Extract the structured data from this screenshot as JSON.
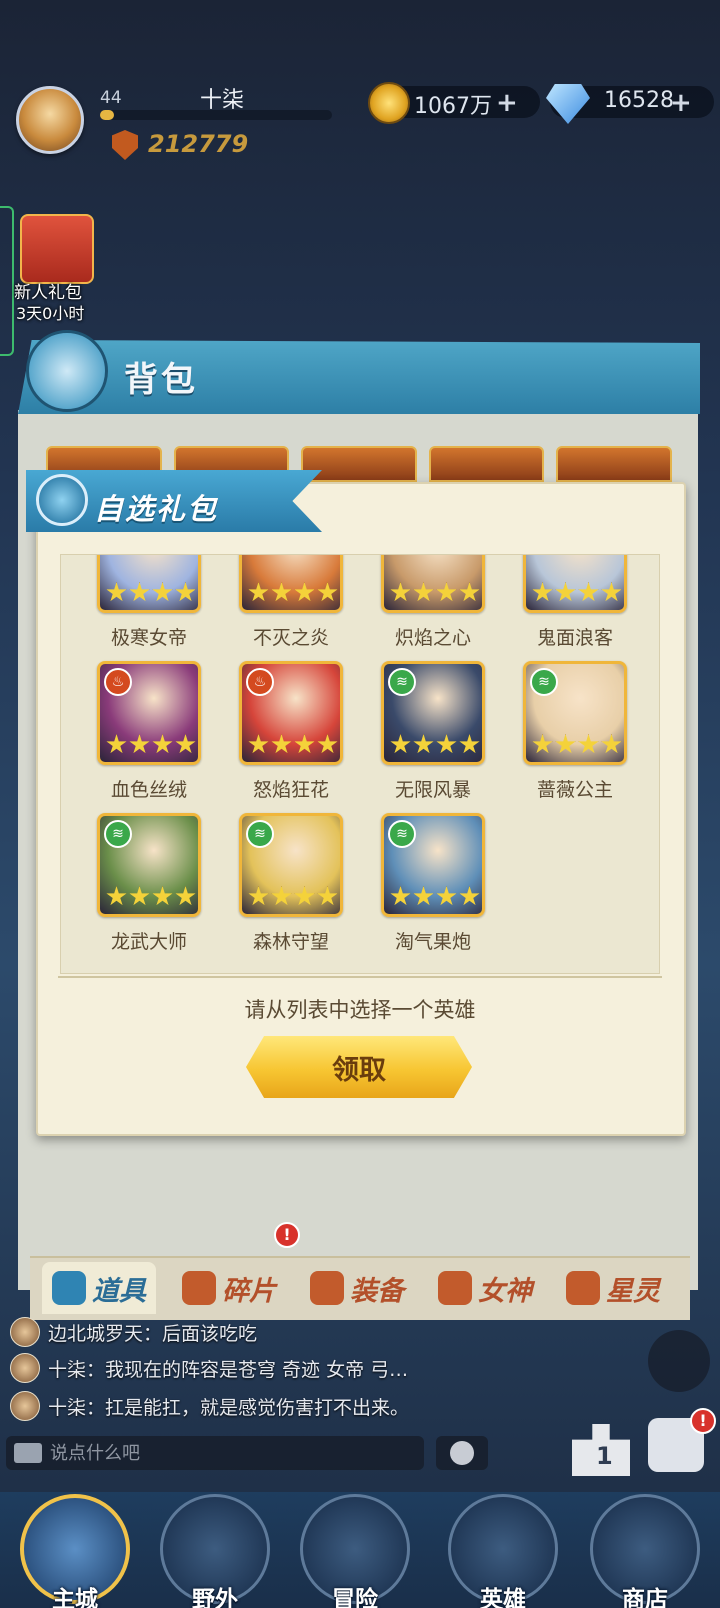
{
  "player": {
    "level": "44",
    "name": "十柒",
    "exp_fraction": 0.06,
    "power": "212779"
  },
  "resources": {
    "gold": "1067万",
    "gems": "16528",
    "plus_label": "+"
  },
  "side_event": {
    "label": "新人礼包",
    "timer": "3天0小时"
  },
  "backpack": {
    "title": "背包"
  },
  "popup": {
    "title": "自选礼包",
    "prompt": "请从列表中选择一个英雄",
    "claim_label": "领取",
    "heroes": [
      {
        "name": "极寒女帝",
        "element": "none",
        "stars": 4,
        "color": "#9fb4e0"
      },
      {
        "name": "不灭之炎",
        "element": "none",
        "stars": 4,
        "color": "#d87a3a"
      },
      {
        "name": "炽焰之心",
        "element": "none",
        "stars": 4,
        "color": "#c89a6a"
      },
      {
        "name": "鬼面浪客",
        "element": "none",
        "stars": 4,
        "color": "#b8c6d8"
      },
      {
        "name": "血色丝绒",
        "element": "fire",
        "stars": 4,
        "color": "#8a3b7a"
      },
      {
        "name": "怒焰狂花",
        "element": "fire",
        "stars": 4,
        "color": "#d6453a"
      },
      {
        "name": "无限风暴",
        "element": "wind",
        "stars": 4,
        "color": "#3a4a6a"
      },
      {
        "name": "蔷薇公主",
        "element": "wind",
        "stars": 4,
        "color": "#e8cfa8"
      },
      {
        "name": "龙武大师",
        "element": "wind",
        "stars": 4,
        "color": "#6b8f4a"
      },
      {
        "name": "森林守望",
        "element": "wind",
        "stars": 4,
        "color": "#e3c25a"
      },
      {
        "name": "淘气果炮",
        "element": "wind",
        "stars": 4,
        "color": "#5f8fb8"
      }
    ]
  },
  "tabs": [
    {
      "label": "道具",
      "active": true
    },
    {
      "label": "碎片",
      "badge": "!"
    },
    {
      "label": "装备"
    },
    {
      "label": "女神"
    },
    {
      "label": "星灵"
    }
  ],
  "chat": {
    "lines": [
      {
        "text": "边北城罗天：后面该吃吃"
      },
      {
        "text": "十柒：我现在的阵容是苍穹 奇迹 女帝 弓…"
      },
      {
        "text": "十柒：扛是能扛，就是感觉伤害打不出来。"
      }
    ],
    "placeholder": "说点什么吧"
  },
  "side_buttons": {
    "rank_label": "1",
    "chest_badge": "!"
  },
  "nav": [
    {
      "label": "主城",
      "active": true
    },
    {
      "label": "野外"
    },
    {
      "label": "冒险"
    },
    {
      "label": "英雄"
    },
    {
      "label": "商店"
    }
  ],
  "colors": {
    "accent_blue": "#2d7fa6",
    "gold": "#f7c632",
    "popup_bg": "#f5f0dc",
    "fire": "#d44a1f",
    "wind": "#3aa84a"
  }
}
